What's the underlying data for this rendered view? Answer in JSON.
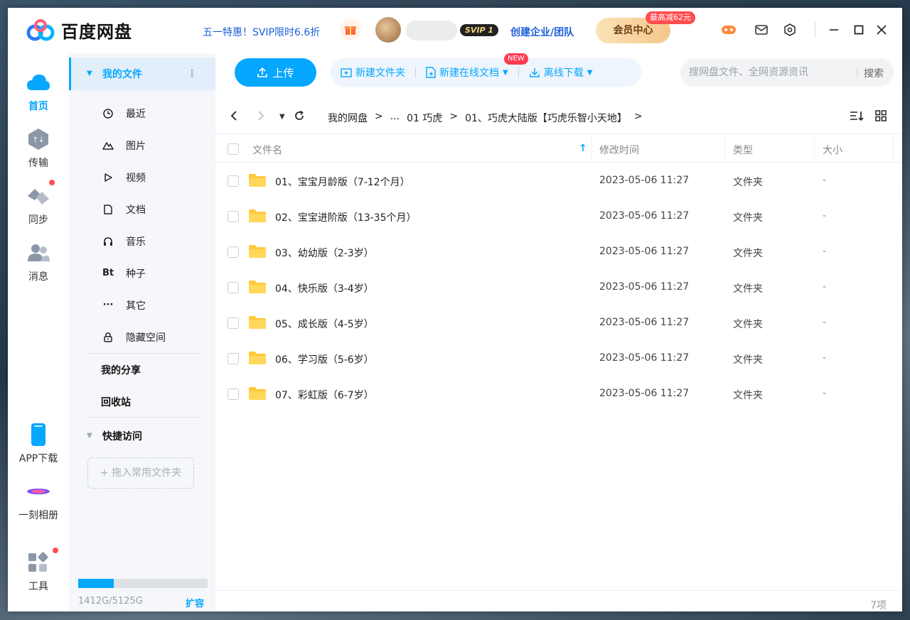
{
  "app": {
    "title": "百度网盘"
  },
  "header": {
    "promo": "五一特惠！SVIP限时6.6折",
    "svip_badge": "SVIP 1",
    "enterprise_link": "创建企业/团队",
    "vip_button": "会员中心",
    "vip_badge": "最高减62元"
  },
  "rail": {
    "items": [
      {
        "label": "首页",
        "icon": "cloud-icon"
      },
      {
        "label": "传输",
        "icon": "transfer-icon"
      },
      {
        "label": "同步",
        "icon": "sync-icon"
      },
      {
        "label": "消息",
        "icon": "message-icon"
      }
    ],
    "bottom": [
      {
        "label": "APP下载",
        "icon": "phone-icon"
      },
      {
        "label": "一刻相册",
        "icon": "album-icon"
      },
      {
        "label": "工具",
        "icon": "tools-icon"
      }
    ]
  },
  "sidebar": {
    "my_files": "我的文件",
    "items": [
      {
        "label": "最近",
        "icon": "clock-icon"
      },
      {
        "label": "图片",
        "icon": "image-icon"
      },
      {
        "label": "视频",
        "icon": "video-icon"
      },
      {
        "label": "文档",
        "icon": "document-icon"
      },
      {
        "label": "音乐",
        "icon": "headphones-icon"
      },
      {
        "label": "种子",
        "icon": "Bt"
      },
      {
        "label": "其它",
        "icon": "···"
      },
      {
        "label": "隐藏空间",
        "icon": "lock-icon"
      }
    ],
    "share": "我的分享",
    "recycle": "回收站",
    "quick_access": "快捷访问",
    "drag_hint": "+ 拖入常用文件夹",
    "quota_text": "1412G/5125G",
    "quota_fraction": 0.2755,
    "expand": "扩容"
  },
  "toolbar": {
    "upload": "上传",
    "new_folder": "新建文件夹",
    "new_online_doc": "新建在线文档",
    "new_badge": "NEW",
    "offline_download": "离线下载",
    "search_placeholder": "搜网盘文件、全网资源资讯",
    "search_button": "搜索"
  },
  "breadcrumb": {
    "items": [
      "我的网盘",
      ">",
      "...",
      "01 巧虎",
      ">",
      "01、巧虎大陆版【巧虎乐智小天地】",
      ">"
    ]
  },
  "table": {
    "columns": {
      "name": "文件名",
      "modified": "修改时间",
      "type": "类型",
      "size": "大小"
    },
    "rows": [
      {
        "name": "01、宝宝月龄版（7-12个月）",
        "modified": "2023-05-06 11:27",
        "type": "文件夹",
        "size": "-"
      },
      {
        "name": "02、宝宝进阶版（13-35个月）",
        "modified": "2023-05-06 11:27",
        "type": "文件夹",
        "size": "-"
      },
      {
        "name": "03、幼幼版（2-3岁）",
        "modified": "2023-05-06 11:27",
        "type": "文件夹",
        "size": "-"
      },
      {
        "name": "04、快乐版（3-4岁）",
        "modified": "2023-05-06 11:27",
        "type": "文件夹",
        "size": "-"
      },
      {
        "name": "05、成长版（4-5岁）",
        "modified": "2023-05-06 11:27",
        "type": "文件夹",
        "size": "-"
      },
      {
        "name": "06、学习版（5-6岁）",
        "modified": "2023-05-06 11:27",
        "type": "文件夹",
        "size": "-"
      },
      {
        "name": "07、彩虹版（6-7岁）",
        "modified": "2023-05-06 11:27",
        "type": "文件夹",
        "size": "-"
      }
    ]
  },
  "footer": {
    "count": "7项"
  },
  "colors": {
    "accent": "#06a7ff",
    "link": "#1c5fd9",
    "folder": "#ffc93c",
    "badge": "#ff4d4f"
  }
}
